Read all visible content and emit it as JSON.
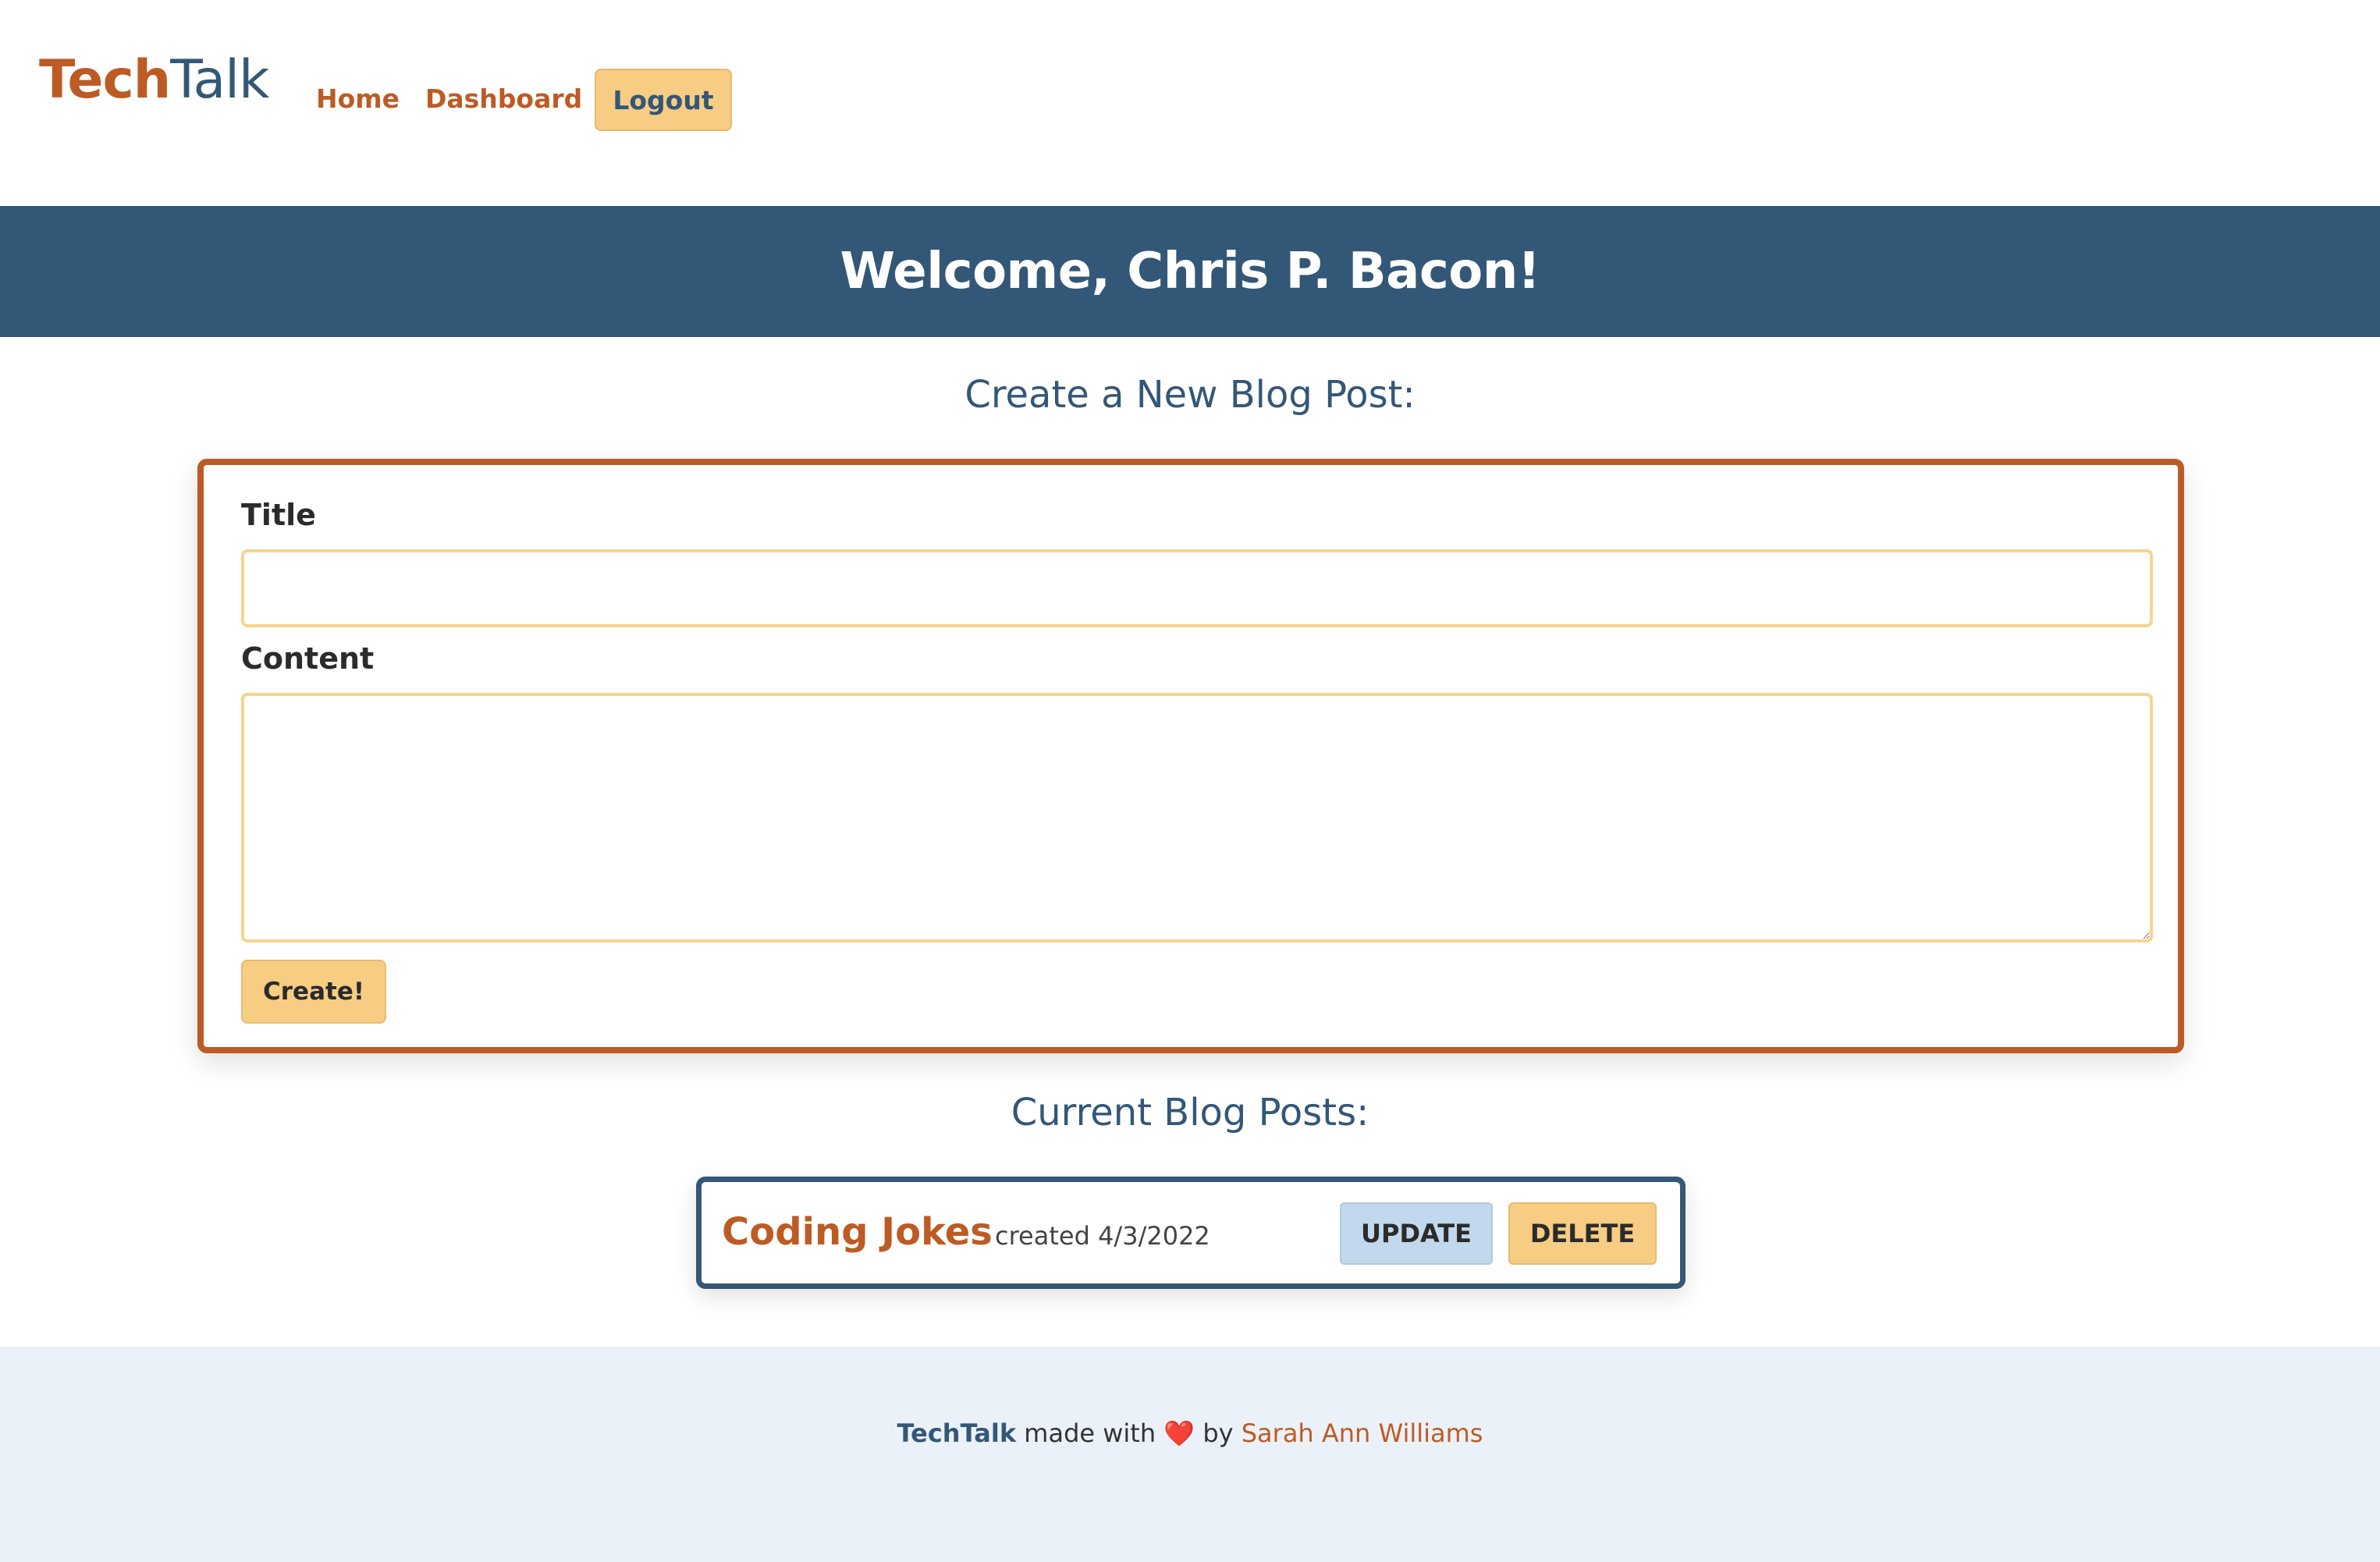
{
  "navbar": {
    "brand_part1": "Tech",
    "brand_part2": "Talk",
    "links": [
      {
        "label": "Home"
      },
      {
        "label": "Dashboard"
      }
    ],
    "logout_label": "Logout"
  },
  "hero": {
    "heading": "Welcome, Chris P. Bacon!"
  },
  "create_section": {
    "heading": "Create a New Blog Post:",
    "title_label": "Title",
    "title_value": "",
    "content_label": "Content",
    "content_value": "",
    "submit_label": "Create!"
  },
  "posts_section": {
    "heading": "Current Blog Posts:",
    "posts": [
      {
        "title": "Coding Jokes",
        "meta": "created 4/3/2022",
        "update_label": "UPDATE",
        "delete_label": "DELETE"
      }
    ]
  },
  "footer": {
    "brand": "TechTalk",
    "made_with": "made with",
    "heart": "❤️",
    "by": "by",
    "author": "Sarah Ann Williams"
  },
  "colors": {
    "primary_navy": "#335777",
    "accent_orange": "#bd5b25",
    "button_yellow": "#f7cc83",
    "button_blue": "#c2d8ec",
    "footer_bg": "#eaf1f8"
  },
  "icons": {
    "heart": "heart-icon"
  }
}
